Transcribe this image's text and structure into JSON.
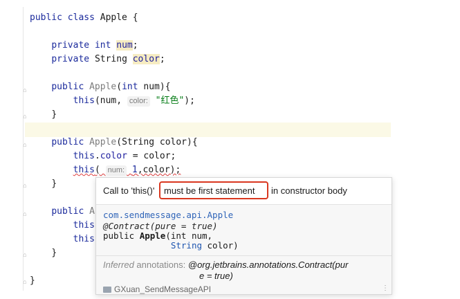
{
  "code": {
    "line1": {
      "kw": "public class",
      "name": "Apple",
      "brace": " {"
    },
    "line2": {
      "kw1": "private",
      "kw2": "int",
      "field": "num",
      "end": ";"
    },
    "line3": {
      "kw1": "private",
      "type": "String",
      "field": "color",
      "end": ";"
    },
    "line4": {
      "kw": "public",
      "name": "Apple",
      "open": "(",
      "kw2": "int",
      "rest": " num){"
    },
    "line5": {
      "kw": "this",
      "a": "(num, ",
      "hint": "color:",
      "str": "\"红色\"",
      "end": ");"
    },
    "line6": {
      "text": "}"
    },
    "line7": {
      "kw": "public",
      "name": "Apple",
      "rest": "(String color){"
    },
    "line8": {
      "kw": "this",
      "dot": ".",
      "field": "color",
      "rest": " = color;"
    },
    "line9": {
      "kw": "this",
      "open": "( ",
      "hint": "num:",
      "num": "1",
      "rest": ",color);"
    },
    "line10": {
      "text": "}"
    },
    "line11": {
      "kw": "public",
      "partial": "A"
    },
    "line12": {
      "kw": "this"
    },
    "line13": {
      "kw": "this"
    },
    "line14": {
      "text": "}"
    },
    "line15": {
      "text": "}"
    }
  },
  "popup": {
    "error_before": "Call to 'this()'",
    "error_highlight": "must be first statement",
    "error_after": "in constructor body",
    "doc_class": "com.sendmessage.api.Apple",
    "doc_annotation": "@Contract(pure = true)",
    "doc_sig_prefix": "public",
    "doc_sig_name": "Apple",
    "doc_sig_params1": "(int num,",
    "doc_sig_type2": "String",
    "doc_sig_params2": " color)",
    "inferred_label": "Inferred",
    "inferred_rest": " annotations: ",
    "inferred_value1": "@org.jetbrains.annotations.Contract(pur",
    "inferred_value2": "e = true)",
    "bottom_label": "GXuan_SendMessageAPI"
  },
  "colors": {
    "keyword": "#1b2a9c",
    "string": "#067d17",
    "error_box": "#d9371f",
    "doc_link": "#2f64b8"
  }
}
